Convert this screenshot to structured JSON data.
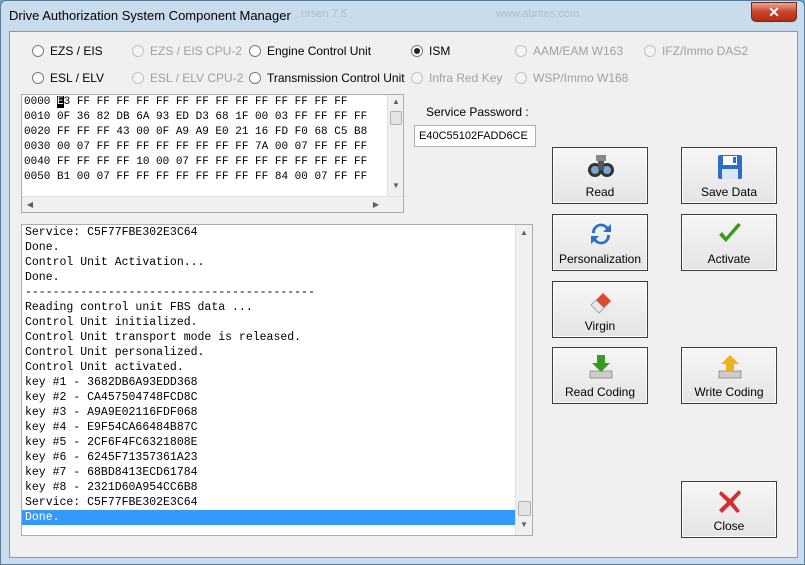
{
  "window": {
    "title": "Drive Authorization System Component Manager",
    "faint_text_1": "ursen 7.5",
    "faint_text_2": "www.abrites.com",
    "close_glyph": "✕"
  },
  "radios": [
    {
      "label": "EZS / EIS",
      "selected": false,
      "enabled": true
    },
    {
      "label": "EZS / EIS CPU-2",
      "selected": false,
      "enabled": false
    },
    {
      "label": "Engine Control Unit",
      "selected": false,
      "enabled": true
    },
    {
      "label": "ISM",
      "selected": true,
      "enabled": true
    },
    {
      "label": "AAM/EAM W163",
      "selected": false,
      "enabled": false
    },
    {
      "label": "IFZ/Immo DAS2",
      "selected": false,
      "enabled": false
    },
    {
      "label": "ESL / ELV",
      "selected": false,
      "enabled": true
    },
    {
      "label": "ESL / ELV CPU-2",
      "selected": false,
      "enabled": false
    },
    {
      "label": "Transmission Control Unit",
      "selected": false,
      "enabled": true
    },
    {
      "label": "Infra Red Key",
      "selected": false,
      "enabled": false
    },
    {
      "label": "WSP/Immo W168",
      "selected": false,
      "enabled": false
    }
  ],
  "hex": {
    "cursor_char": "E",
    "first_line_prefix": "0000 ",
    "first_line_rest": "3 FF FF FF FF FF FF FF FF FF FF FF FF FF FF",
    "lines": [
      "0010 0F 36 82 DB 6A 93 ED D3 68 1F 00 03 FF FF FF FF",
      "0020 FF FF FF 43 00 0F A9 A9 E0 21 16 FD F0 68 C5 B8",
      "0030 00 07 FF FF FF FF FF FF FF FF 7A 00 07 FF FF FF",
      "0040 FF FF FF FF 10 00 07 FF FF FF FF FF FF FF FF FF",
      "0050 B1 00 07 FF FF FF FF FF FF FF FF 84 00 07 FF FF"
    ]
  },
  "service_password": {
    "label": "Service Password :",
    "value": "E40C55102FADD6CE"
  },
  "log": {
    "lines": [
      "Service: C5F77FBE302E3C64",
      "Done.",
      "Control Unit Activation...",
      "Done.",
      "------------------------------------------",
      "Reading control unit FBS data ...",
      "Control Unit initialized.",
      "Control Unit transport mode is released.",
      "Control Unit personalized.",
      "Control Unit activated.",
      "key #1 - 3682DB6A93EDD368",
      "key #2 - CA457504748FCD8C",
      "key #3 - A9A9E02116FDF068",
      "key #4 - E9F54CA66484B87C",
      "key #5 - 2CF6F4FC6321808E",
      "key #6 - 6245F71357361A23",
      "key #7 - 68BD8413ECD61784",
      "key #8 - 2321D60A954CC6B8",
      "Service: C5F77FBE302E3C64"
    ],
    "selected_line": "Done."
  },
  "buttons": {
    "read": "Read",
    "save_data": "Save Data",
    "personalization": "Personalization",
    "activate": "Activate",
    "virgin": "Virgin",
    "read_coding": "Read Coding",
    "write_coding": "Write Coding",
    "close": "Close"
  },
  "colors": {
    "selection": "#3399ff",
    "activate_check": "#3a9a1e",
    "close_x": "#d03030"
  }
}
